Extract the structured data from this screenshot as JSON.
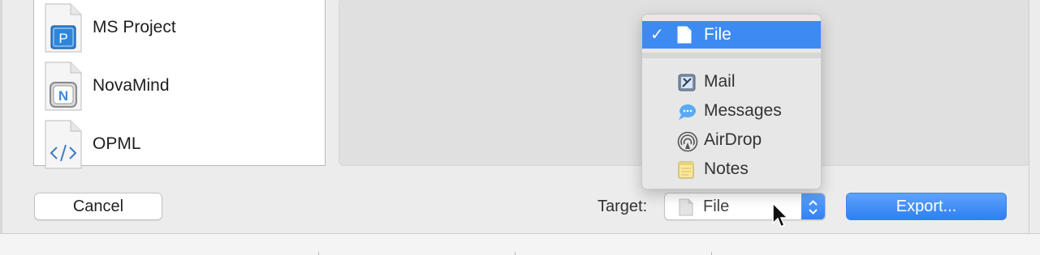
{
  "format_list": {
    "items": [
      {
        "label": "MS Project",
        "icon": "ms-project-file-icon"
      },
      {
        "label": "NovaMind",
        "icon": "novamind-file-icon"
      },
      {
        "label": "OPML",
        "icon": "opml-file-icon"
      }
    ]
  },
  "buttons": {
    "cancel_label": "Cancel",
    "export_label": "Export..."
  },
  "target": {
    "label": "Target:",
    "selected_value": "File"
  },
  "target_menu": {
    "selected": {
      "label": "File",
      "icon": "document-icon",
      "checked": true
    },
    "items": [
      {
        "label": "Mail",
        "icon": "mail-icon"
      },
      {
        "label": "Messages",
        "icon": "messages-icon"
      },
      {
        "label": "AirDrop",
        "icon": "airdrop-icon"
      },
      {
        "label": "Notes",
        "icon": "notes-icon"
      }
    ]
  },
  "colors": {
    "accent": "#3d8bf2",
    "window_background": "#ececec"
  }
}
